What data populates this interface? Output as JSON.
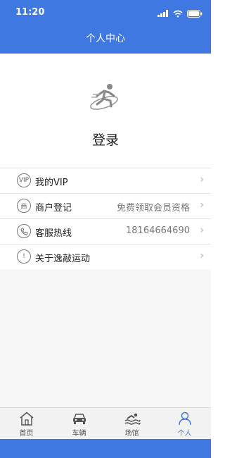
{
  "status_bar": {
    "time": "11:20"
  },
  "header": {
    "title": "个人中心"
  },
  "profile": {
    "login_text": "登录"
  },
  "menu": [
    {
      "icon": "vip-icon",
      "icon_text": "VIP",
      "label": "我的VIP",
      "value": ""
    },
    {
      "icon": "merchant-icon",
      "icon_text": "商",
      "label": "商户登记",
      "value": "免费领取会员资格"
    },
    {
      "icon": "phone-icon",
      "icon_text": "",
      "label": "客服热线",
      "value": "18164664690"
    },
    {
      "icon": "info-icon",
      "icon_text": "!",
      "label": "关于逸敲运动",
      "value": ""
    }
  ],
  "tabs": [
    {
      "icon": "home-icon",
      "label": "首页",
      "active": false
    },
    {
      "icon": "car-icon",
      "label": "车辆",
      "active": false
    },
    {
      "icon": "swim-icon",
      "label": "场馆",
      "active": false
    },
    {
      "icon": "person-icon",
      "label": "个人",
      "active": true
    }
  ],
  "colors": {
    "accent": "#3f78e0"
  }
}
